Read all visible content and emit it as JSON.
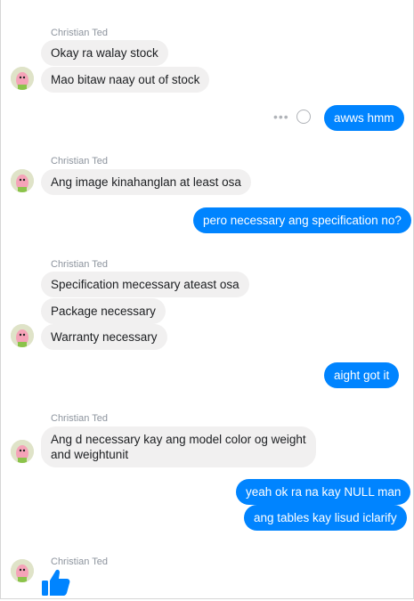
{
  "sender_name": "Christian Ted",
  "groups": [
    {
      "name": "Christian Ted",
      "messages": [
        "Okay ra walay stock",
        "Mao bitaw naay out of stock"
      ]
    },
    {
      "reply": [
        "awws hmm"
      ]
    },
    {
      "name": "Christian Ted",
      "messages": [
        "Ang image kinahanglan at least osa"
      ]
    },
    {
      "reply": [
        "pero necessary ang specification no?"
      ]
    },
    {
      "name": "Christian Ted",
      "messages": [
        "Specification mecessary ateast osa",
        "Package necessary",
        "Warranty necessary"
      ]
    },
    {
      "reply": [
        "aight got it"
      ]
    },
    {
      "name": "Christian Ted",
      "messages": [
        "Ang d necessary kay ang model color og weight\nand weightunit"
      ]
    },
    {
      "reply": [
        "yeah ok ra na kay NULL man",
        "ang tables kay lisud iclarify"
      ]
    },
    {
      "name": "Christian Ted",
      "messages": []
    }
  ],
  "icons": {
    "more": "more-dots-icon",
    "react": "smiley-icon",
    "like": "thumbs-up-icon"
  },
  "colors": {
    "outgoing": "#0084ff",
    "incoming": "#f1f0f0",
    "like": "#0084ff"
  }
}
